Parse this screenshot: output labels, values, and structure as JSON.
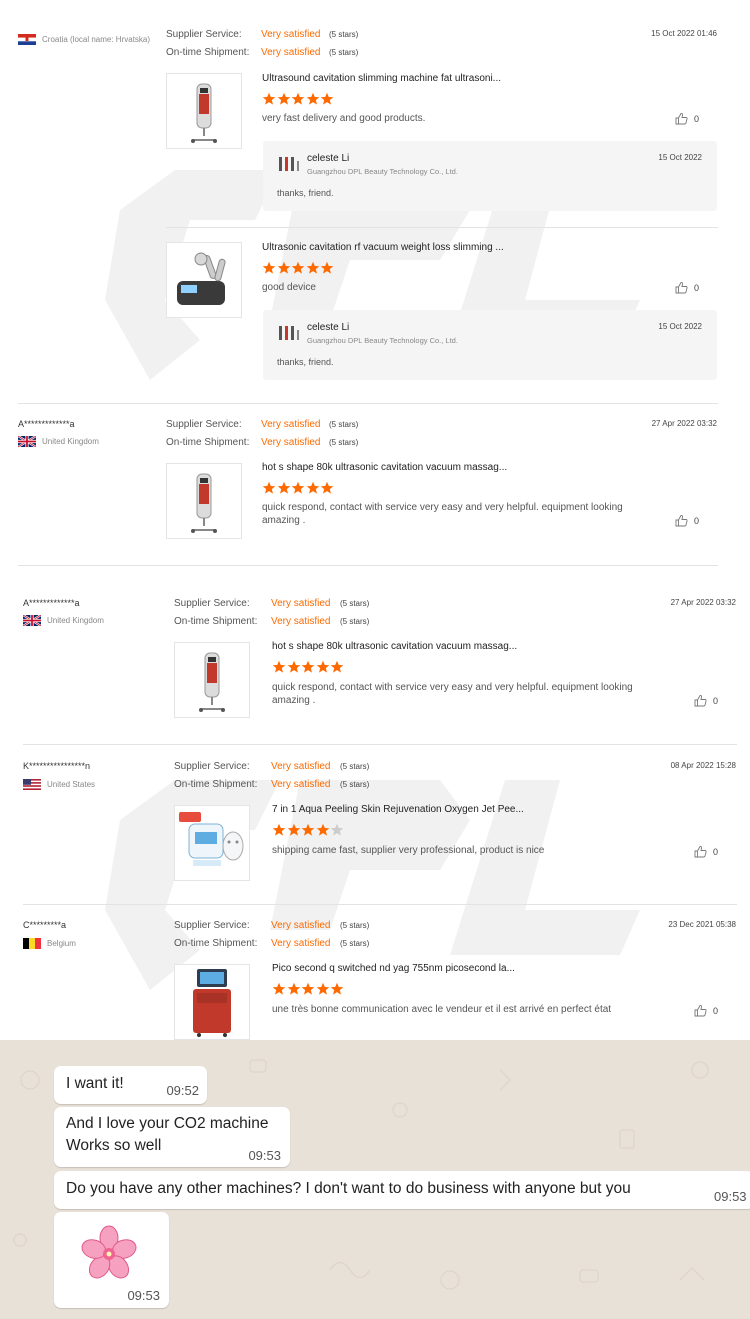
{
  "labels": {
    "supplier_service": "Supplier Service:",
    "ontime_shipment": "On-time Shipment:",
    "very_satisfied": "Very satisfied",
    "five_stars": "(5 stars)"
  },
  "colors": {
    "accent": "#ff6a00",
    "star_empty": "#cccccc",
    "chat_bg": "#e8e1d7"
  },
  "reviews": [
    {
      "buyer": "",
      "country": "Croatia (local name: Hrvatska)",
      "flag": "croatia-flag",
      "date": "15 Oct 2022 01:46",
      "items": [
        {
          "product": "Ultrasound cavitation slimming machine fat ultrasoni...",
          "rating": 5,
          "text": "very fast delivery and good products.",
          "likes": "0",
          "reply": {
            "name": "celeste Li",
            "company": "Guangzhou DPL Beauty Technology Co., Ltd.",
            "date": "15 Oct 2022",
            "text": "thanks, friend."
          }
        },
        {
          "product": "Ultrasonic cavitation rf vacuum weight loss slimming ...",
          "rating": 5,
          "text": "good device",
          "likes": "0",
          "reply": {
            "name": "celeste Li",
            "company": "Guangzhou DPL Beauty Technology Co., Ltd.",
            "date": "15 Oct 2022",
            "text": "thanks, friend."
          }
        }
      ]
    },
    {
      "buyer": "A*************a",
      "country": "United Kingdom",
      "flag": "uk-flag",
      "date": "27 Apr 2022 03:32",
      "items": [
        {
          "product": "hot s shape 80k ultrasonic cavitation vacuum massag...",
          "rating": 5,
          "text_line1": "quick respond, contact with service very easy and very helpful. equipment looking",
          "text_line2": "amazing .",
          "likes": "0"
        }
      ]
    },
    {
      "buyer": "A*************a",
      "country": "United Kingdom",
      "flag": "uk-flag",
      "date": "27 Apr 2022 03:32",
      "items": [
        {
          "product": "hot s shape 80k ultrasonic cavitation vacuum massag...",
          "rating": 5,
          "text_line1": "quick respond, contact with service very easy and very helpful. equipment looking",
          "text_line2": "amazing .",
          "likes": "0"
        }
      ]
    },
    {
      "buyer": "K****************n",
      "country": "United States",
      "flag": "us-flag",
      "date": "08 Apr 2022 15:28",
      "items": [
        {
          "product": "7 in 1 Aqua Peeling Skin Rejuvenation Oxygen Jet Pee...",
          "rating": 4,
          "text": "shipping came fast, supplier very professional, product is nice",
          "likes": "0"
        }
      ]
    },
    {
      "buyer": "C*********a",
      "country": "Belgium",
      "flag": "belgium-flag",
      "date": "23 Dec 2021 05:38",
      "items": [
        {
          "product": "Pico second q switched nd yag 755nm picosecond la...",
          "rating": 5,
          "text": "une très bonne communication avec le vendeur et il est arrivé en perfect état",
          "likes": "0"
        }
      ]
    }
  ],
  "chat": [
    {
      "text": "I want it!",
      "time": "09:52"
    },
    {
      "text_line1": "And I love your CO2 machine",
      "text_line2": "Works so well",
      "time": "09:53"
    },
    {
      "text": "Do you have any other machines? I don't want to do business with anyone but you",
      "time": "09:53"
    },
    {
      "sticker": "cherry-blossom-sticker",
      "time": "09:53"
    }
  ]
}
